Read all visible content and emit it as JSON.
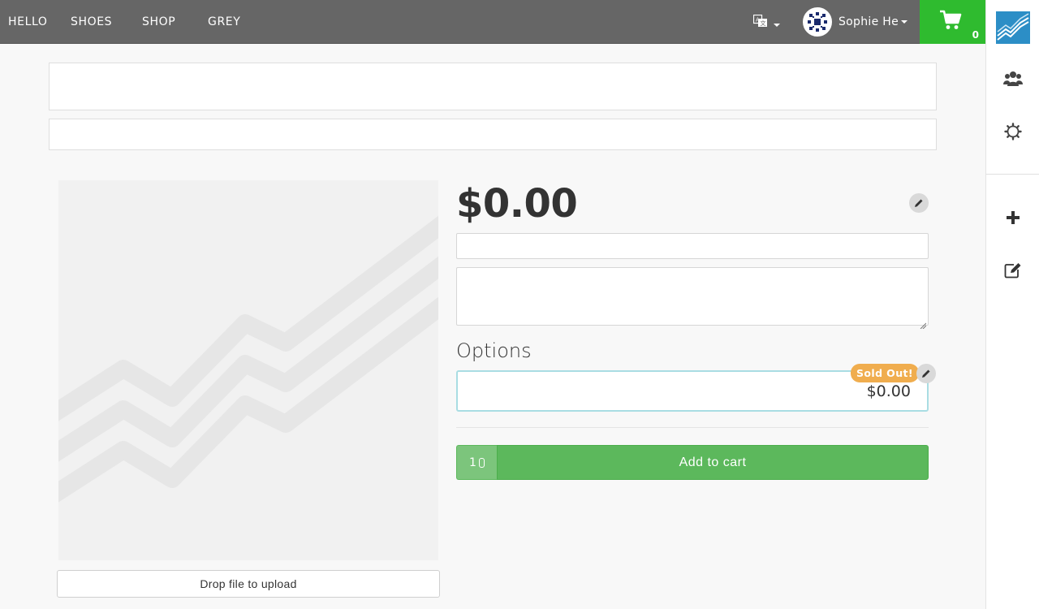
{
  "topnav": {
    "links": [
      "HELLO",
      "SHOES",
      "SHOP",
      "GREY"
    ],
    "language_icon": "translate-icon",
    "user_name": "Sophie He",
    "cart_count": "0",
    "cart_icon": "shopping-cart-icon",
    "cart_color": "#2fbb2f",
    "bar_color": "#666666"
  },
  "sidebar": {
    "icons": [
      "app-logo-icon",
      "users-icon",
      "gear-icon",
      "plus-icon",
      "edit-icon"
    ],
    "logo_color": "#2c8ec6"
  },
  "product": {
    "price": "$0.00",
    "options_heading": "Options",
    "option": {
      "price": "$0.00",
      "badge": "Sold Out!",
      "badge_color": "#f0ad4e"
    },
    "quantity": "1",
    "add_to_cart_label": "Add to cart",
    "add_to_cart_color": "#5cb85c",
    "upload_label": "Drop file to upload"
  }
}
